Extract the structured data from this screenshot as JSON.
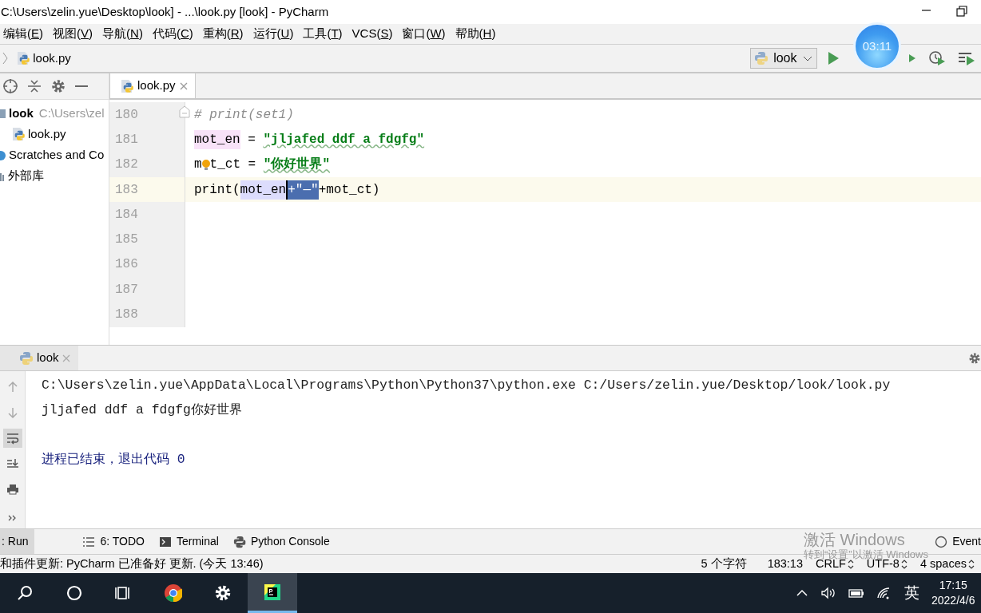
{
  "window": {
    "title": "C:\\Users\\zelin.yue\\Desktop\\look] - ...\\look.py [look] - PyCharm"
  },
  "menu": [
    "编辑(E)",
    "视图(V)",
    "导航(N)",
    "代码(C)",
    "重构(R)",
    "运行(U)",
    "工具(T)",
    "VCS(S)",
    "窗口(W)",
    "帮助(H)"
  ],
  "breadcrumb": "look.py",
  "run_config": "look",
  "timer": "03:11",
  "project_tree": [
    {
      "label": "look",
      "kind": "project",
      "path": "C:\\Users\\zel",
      "children": [
        {
          "label": "look.py",
          "kind": "python"
        }
      ]
    },
    {
      "label": "Scratches and Co",
      "kind": "scratches"
    },
    {
      "label": "外部库",
      "kind": "library"
    }
  ],
  "editor_tabs": [
    {
      "label": "look.py",
      "selected": true
    }
  ],
  "code_lines": [
    {
      "number": "180",
      "current": false,
      "tokens": [
        {
          "kind": "comment",
          "text": "# print(set1)"
        }
      ]
    },
    {
      "number": "181",
      "current": false,
      "tokens": [
        {
          "kind": "highlight",
          "text": "mot_en"
        },
        {
          "kind": "plain",
          "text": " = "
        },
        {
          "kind": "string",
          "text": "\"jljafed ddf a fdgfg\""
        }
      ]
    },
    {
      "number": "182",
      "current": false,
      "tokens": [
        {
          "kind": "plain",
          "text": "m"
        },
        {
          "kind": "bulb"
        },
        {
          "kind": "plain",
          "text": "t_ct = "
        },
        {
          "kind": "string",
          "text": "\"你好世界\""
        }
      ]
    },
    {
      "number": "183",
      "current": true,
      "tokens": [
        {
          "kind": "plain",
          "text": "print("
        },
        {
          "kind": "usage",
          "text": "mot_en"
        },
        {
          "kind": "selected",
          "text": "+\"—\""
        },
        {
          "kind": "plain",
          "text": "+mot_ct)"
        }
      ]
    },
    {
      "number": "184",
      "current": false
    },
    {
      "number": "185",
      "current": false
    },
    {
      "number": "186",
      "current": false
    },
    {
      "number": "187",
      "current": false
    },
    {
      "number": "188",
      "current": false
    }
  ],
  "run_tabs": [
    {
      "label": "look",
      "selected": true
    }
  ],
  "console_tools": [
    {
      "kind": "up",
      "selected": false
    },
    {
      "kind": "down",
      "selected": false
    },
    {
      "kind": "wrap",
      "selected": true
    },
    {
      "kind": "scroll-end",
      "selected": false
    },
    {
      "kind": "print",
      "selected": false
    },
    {
      "kind": "more",
      "selected": false
    }
  ],
  "console_lines": [
    {
      "kind": "command",
      "text": "C:\\Users\\zelin.yue\\AppData\\Local\\Programs\\Python\\Python37\\python.exe C:/Users/zelin.yue/Desktop/look/look.py"
    },
    {
      "kind": "output",
      "text": "jljafed ddf a fdgfg你好世界"
    },
    {
      "kind": "blank"
    },
    {
      "kind": "exit",
      "text": "进程已结束，退出代码 0"
    }
  ],
  "tool_windows": [
    {
      "label": ": Run",
      "kind": "run",
      "selected": true
    },
    {
      "label": "6: TODO",
      "kind": "todo",
      "selected": false
    },
    {
      "label": "Terminal",
      "kind": "terminal",
      "selected": false
    },
    {
      "label": "Python Console",
      "kind": "console",
      "selected": false
    }
  ],
  "event_log": "Event",
  "watermark": [
    "激活 Windows",
    "转到“设置”以激活 Windows"
  ],
  "status": {
    "message": "和插件更新: PyCharm 已准备好 更新. (今天 13:46)",
    "items": [
      {
        "text": "5 个字符",
        "dropdown": false
      },
      {
        "text": "183:13",
        "dropdown": false
      },
      {
        "text": "CRLF",
        "dropdown": true
      },
      {
        "text": "UTF-8",
        "dropdown": true
      },
      {
        "text": "4 spaces",
        "dropdown": true
      }
    ]
  },
  "taskbar": {
    "apps": [
      {
        "kind": "search",
        "active": false
      },
      {
        "kind": "cortana",
        "active": false
      },
      {
        "kind": "taskview",
        "active": false
      },
      {
        "kind": "chrome",
        "active": false
      },
      {
        "kind": "settings",
        "active": false
      },
      {
        "kind": "pycharm",
        "active": true
      }
    ],
    "ime": "英",
    "time": "17:15",
    "date": "2022/4/6"
  }
}
